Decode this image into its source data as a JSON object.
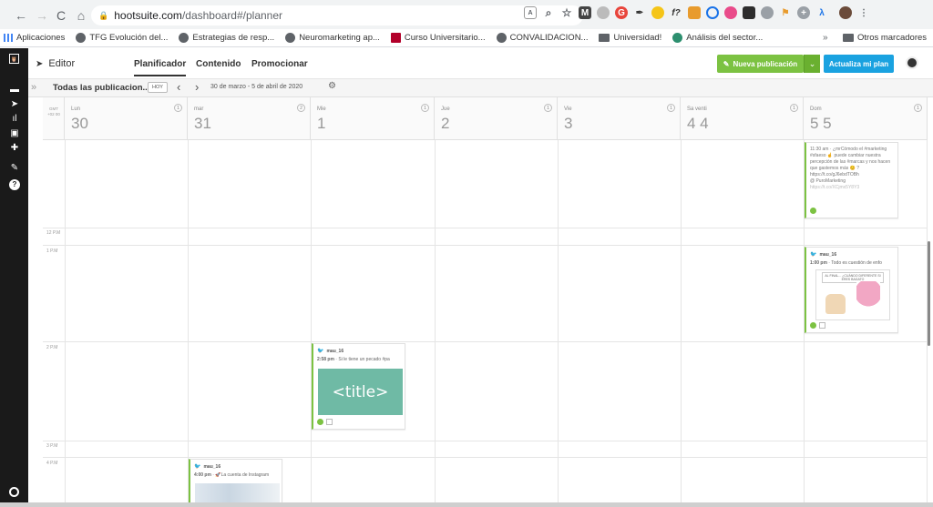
{
  "browser": {
    "url_host": "hootsuite.com",
    "url_path": "/dashboard#/planner",
    "nav": {
      "back": "←",
      "forward": "→",
      "reload": "C",
      "home": "⌂"
    }
  },
  "bookmarks": [
    {
      "label": "Aplicaciones",
      "icon": "apps-icon"
    },
    {
      "label": "TFG Evolución del...",
      "icon": "globe-icon"
    },
    {
      "label": "Estrategias de resp...",
      "icon": "globe-icon"
    },
    {
      "label": "Neuromarketing ap...",
      "icon": "globe-icon"
    },
    {
      "label": "Curso Universitario...",
      "icon": "u-icon"
    },
    {
      "label": "CONVALIDACION...",
      "icon": "globe-icon"
    },
    {
      "label": "Universidad!",
      "icon": "folder-icon"
    },
    {
      "label": "Análisis del sector...",
      "icon": "globe-icon"
    }
  ],
  "bookmarks_more": "»",
  "bookmarks_other": "Otros marcadores",
  "header": {
    "editor_label": "Editor",
    "tabs": [
      "Planificador",
      "Contenido",
      "Promocionar"
    ],
    "new_post": "Nueva publicación",
    "upgrade": "Actualiza mi plan"
  },
  "toolbar": {
    "expand": "»",
    "streams": "Todas las publicacion...",
    "today": "HOY",
    "prev": "‹",
    "next": "›",
    "range": "30 de marzo - 5 de abril de 2020"
  },
  "calendar": {
    "timezone": "GMT +02 00",
    "days": [
      {
        "name": "Lun",
        "num": "30",
        "count": "1"
      },
      {
        "name": "mar",
        "num": "31",
        "count": "2"
      },
      {
        "name": "Mie",
        "num": "1",
        "count": "1"
      },
      {
        "name": "Jue",
        "num": "2",
        "count": "1"
      },
      {
        "name": "Vie",
        "num": "3",
        "count": "1"
      },
      {
        "name": "Sa venti",
        "num": "4 4",
        "count": "1"
      },
      {
        "name": "Dom",
        "num": "5 5",
        "count": "1"
      }
    ],
    "times": [
      "12 P.M",
      "1 P.M",
      "2 P.M",
      "3 P.M",
      "4 P.M"
    ]
  },
  "posts": {
    "sun_11": {
      "time": "11:30 am",
      "text": "¿mrCómodo el #marketing #sfaeso ☝️ puede cambiar nuestra percepción de las #marcas y nos hacen que gastemos más 😊 ? https://t.co/gJ6ebdTOBh",
      "handle": "@ PuroMarketing",
      "link": "https://t.co/XCjmx5Y8Y3"
    },
    "sun_1pm": {
      "user": "mau_16",
      "time": "1:00 pm",
      "text": "Todo es cuestión de enfo",
      "caption": "AL FINAL... ¿CUÁNDO DIFERENTE SI ERES BAGATO"
    },
    "wed_2pm": {
      "user": "mau_16",
      "time": "2:58 pm",
      "text": "Si le tiene un pecado #pa",
      "image_label": "<title>"
    },
    "tue_4pm": {
      "user": "mau_16",
      "time": "4:00 pm",
      "text": "La cuenta de Instagram"
    }
  },
  "colors": {
    "green": "#7cc242",
    "blue": "#1aa2e0",
    "teal": "#6fbaa5",
    "rail": "#1a1a1a"
  }
}
